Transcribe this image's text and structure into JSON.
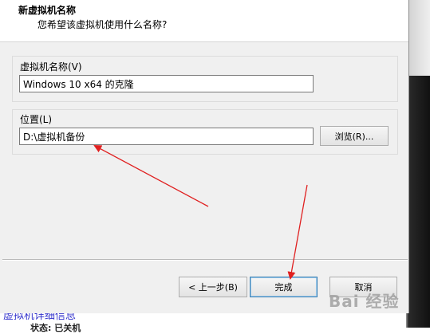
{
  "header": {
    "title": "新虚拟机名称",
    "subtitle": "您希望该虚拟机使用什么名称?"
  },
  "name_group": {
    "label": "虚拟机名称(V)",
    "value": "Windows 10 x64 的克隆"
  },
  "location_group": {
    "label": "位置(L)",
    "value": "D:\\虚拟机备份",
    "browse_label": "浏览(R)..."
  },
  "footer": {
    "back_label": "< 上一步(B)",
    "finish_label": "完成",
    "cancel_label": "取消"
  },
  "background": {
    "details_link": "虚拟机详细信息",
    "status_text": "状态: 已关机"
  },
  "watermark": "Bai 经验",
  "colors": {
    "arrow": "#e02020",
    "link": "#3333cc",
    "default_button_border": "#3c7fb1"
  }
}
